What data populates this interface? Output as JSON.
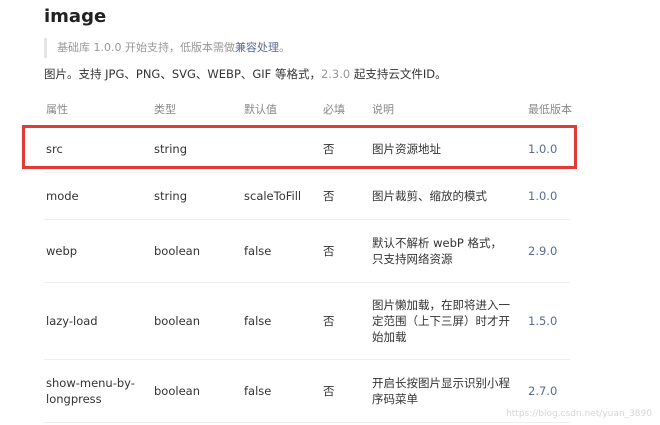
{
  "page": {
    "title": "image",
    "note_prefix": "基础库 1.0.0 开始支持，低版本需做",
    "note_link": "兼容处理",
    "note_suffix": "。",
    "desc_prefix": "图片。支持 JPG、PNG、SVG、WEBP、GIF 等格式，",
    "desc_version": "2.3.0",
    "desc_suffix": " 起支持云文件ID。"
  },
  "table": {
    "headers": [
      "属性",
      "类型",
      "默认值",
      "必填",
      "说明",
      "最低版本"
    ],
    "rows": [
      [
        "src",
        "string",
        "",
        "否",
        "图片资源地址",
        "1.0.0"
      ],
      [
        "mode",
        "string",
        "scaleToFill",
        "否",
        "图片裁剪、缩放的模式",
        "1.0.0"
      ],
      [
        "webp",
        "boolean",
        "false",
        "否",
        "默认不解析 webP 格式，只支持网络资源",
        "2.9.0"
      ],
      [
        "lazy-load",
        "boolean",
        "false",
        "否",
        "图片懒加载，在即将进入一定范围（上下三屏）时才开始加载",
        "1.5.0"
      ],
      [
        "show-menu-by-longpress",
        "boolean",
        "false",
        "否",
        "开启长按图片显示识别小程序码菜单",
        "2.7.0"
      ]
    ]
  },
  "colors": {
    "highlight_border": "#e53935",
    "link": "#576b95"
  },
  "watermark": "https://blog.csdn.net/yuan_3890"
}
